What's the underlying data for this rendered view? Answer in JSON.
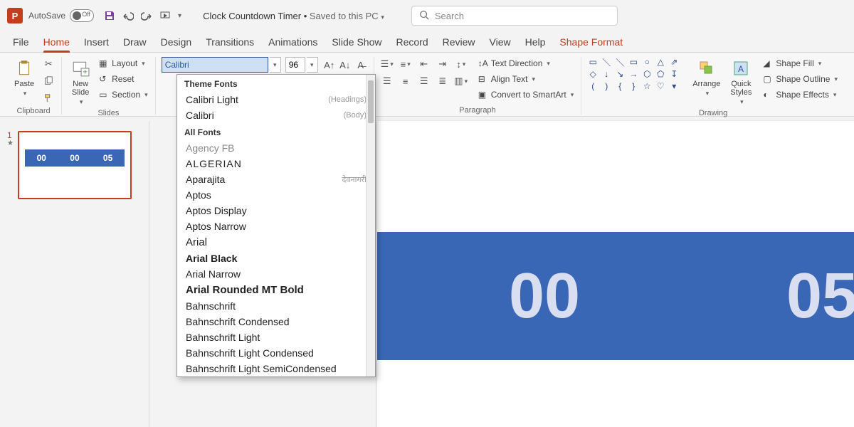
{
  "titlebar": {
    "autosave_label": "AutoSave",
    "autosave_state": "Off",
    "doc_name": "Clock Countdown Timer",
    "saved_status": "Saved to this PC",
    "search_placeholder": "Search"
  },
  "tabs": [
    "File",
    "Home",
    "Insert",
    "Draw",
    "Design",
    "Transitions",
    "Animations",
    "Slide Show",
    "Record",
    "Review",
    "View",
    "Help",
    "Shape Format"
  ],
  "active_tab": "Home",
  "ribbon": {
    "clipboard": {
      "label": "Clipboard",
      "paste": "Paste"
    },
    "slides": {
      "label": "Slides",
      "new_slide": "New\nSlide",
      "layout": "Layout",
      "reset": "Reset",
      "section": "Section"
    },
    "font_value": "Calibri",
    "size_value": "96",
    "paragraph": {
      "label": "Paragraph",
      "text_direction": "Text Direction",
      "align_text": "Align Text",
      "convert": "Convert to SmartArt"
    },
    "drawing": {
      "label": "Drawing",
      "arrange": "Arrange",
      "quick_styles": "Quick\nStyles",
      "shape_fill": "Shape Fill",
      "shape_outline": "Shape Outline",
      "shape_effects": "Shape Effects"
    }
  },
  "font_dropdown": {
    "theme_header": "Theme Fonts",
    "theme_items": [
      {
        "name": "Calibri Light",
        "tag": "(Headings)",
        "cls": "f-light"
      },
      {
        "name": "Calibri",
        "tag": "(Body)",
        "cls": "f-body"
      }
    ],
    "all_header": "All Fonts",
    "all_items": [
      {
        "name": "Agency FB",
        "cls": "f-agency"
      },
      {
        "name": "ALGERIAN",
        "cls": "f-algerian"
      },
      {
        "name": "Aparajita",
        "tag": "देवनागरी",
        "cls": ""
      },
      {
        "name": "Aptos",
        "cls": ""
      },
      {
        "name": "Aptos Display",
        "cls": ""
      },
      {
        "name": "Aptos Narrow",
        "cls": ""
      },
      {
        "name": "Arial",
        "cls": "f-arial"
      },
      {
        "name": "Arial Black",
        "cls": "f-arialb"
      },
      {
        "name": "Arial Narrow",
        "cls": "f-arialn"
      },
      {
        "name": "Arial Rounded MT Bold",
        "cls": "f-arialr"
      },
      {
        "name": "Bahnschrift",
        "cls": "f-bahn"
      },
      {
        "name": "Bahnschrift Condensed",
        "cls": "f-bahnc"
      },
      {
        "name": "Bahnschrift Light",
        "cls": "f-bahnl"
      },
      {
        "name": "Bahnschrift Light Condensed",
        "cls": "f-bahnc"
      },
      {
        "name": "Bahnschrift Light SemiCondensed",
        "cls": "f-bahnl"
      }
    ]
  },
  "slide": {
    "number": "1",
    "values": [
      "00",
      "00",
      "05"
    ]
  }
}
